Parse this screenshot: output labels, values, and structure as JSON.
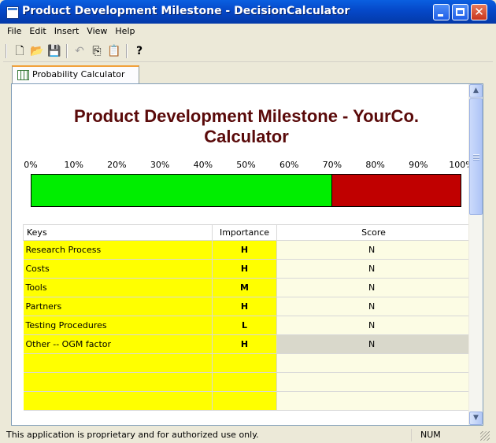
{
  "window": {
    "title": "Product Development Milestone - DecisionCalculator"
  },
  "menu": [
    "File",
    "Edit",
    "Insert",
    "View",
    "Help"
  ],
  "toolbar": {
    "icons": [
      "new-document-icon",
      "open-folder-icon",
      "save-disk-icon",
      "undo-icon",
      "copy-icon",
      "paste-icon",
      "help-icon"
    ],
    "glyphs": {
      "new": "🗋",
      "open": "📂",
      "save": "💾",
      "undo": "↶",
      "copy": "⎘",
      "paste": "📋",
      "help": "?"
    }
  },
  "tab": {
    "label": "Probability Calculator"
  },
  "calculator": {
    "heading_line1": "Product Development Milestone - YourCo.",
    "heading_line2": "Calculator",
    "scale": [
      "0%",
      "10%",
      "20%",
      "30%",
      "40%",
      "50%",
      "60%",
      "70%",
      "80%",
      "90%",
      "100%"
    ],
    "probability_fraction": 0.7,
    "colors": {
      "favorable": "#00ee00",
      "unfavorable": "#c00000",
      "key_cell": "#ffff00",
      "title": "#5a0a0a"
    }
  },
  "table": {
    "headers": {
      "keys": "Keys",
      "importance": "Importance",
      "score": "Score"
    },
    "rows": [
      {
        "key": "Research Process",
        "importance": "H",
        "score": "N"
      },
      {
        "key": "Costs",
        "importance": "H",
        "score": "N"
      },
      {
        "key": "Tools",
        "importance": "M",
        "score": "N"
      },
      {
        "key": "Partners",
        "importance": "H",
        "score": "N"
      },
      {
        "key": "Testing Procedures",
        "importance": "L",
        "score": "N"
      },
      {
        "key": "Other -- OGM factor",
        "importance": "H",
        "score": "N"
      },
      {
        "key": "",
        "importance": "",
        "score": ""
      },
      {
        "key": "",
        "importance": "",
        "score": ""
      },
      {
        "key": "",
        "importance": "",
        "score": ""
      }
    ],
    "selected_row": 5
  },
  "status": {
    "message": "This application is proprietary and for authorized use only.",
    "num": "NUM"
  },
  "window_buttons": {
    "close_glyph": "✕"
  },
  "scrollbar": {
    "up_glyph": "▲",
    "down_glyph": "▼"
  }
}
